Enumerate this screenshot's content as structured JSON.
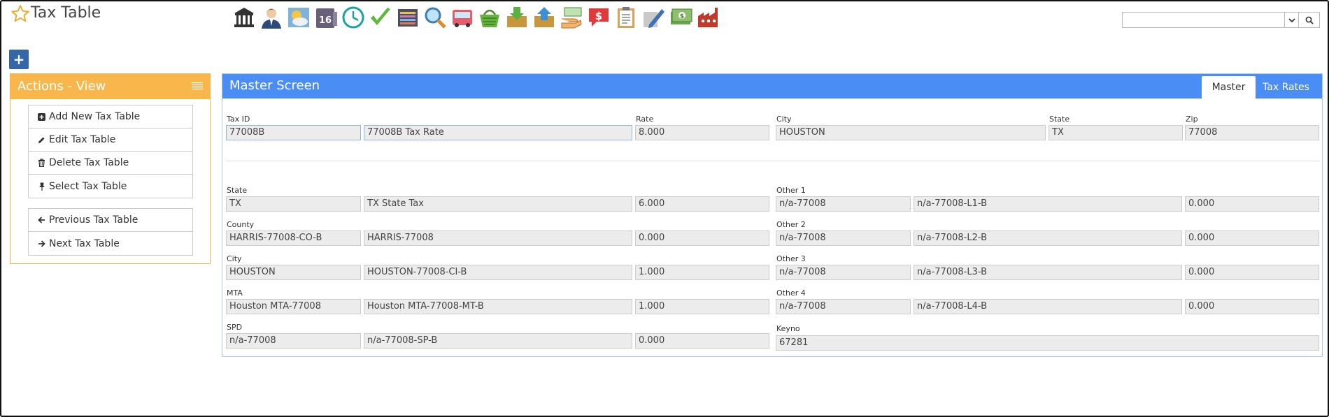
{
  "header": {
    "title": "Tax Table"
  },
  "toolbar": {
    "icons": [
      "bank-icon",
      "user-icon",
      "weather-icon",
      "calendar-icon",
      "clock-icon",
      "checkmark-icon",
      "register-icon",
      "magnifier-icon",
      "bus-icon",
      "basket-icon",
      "download-box-icon",
      "upload-box-icon",
      "cash-hand-icon",
      "chat-dollar-icon",
      "clipboard-icon",
      "pencil-ruler-icon",
      "money-stack-icon",
      "factory-icon"
    ],
    "calendar_day": "16"
  },
  "search": {
    "value": "",
    "placeholder": ""
  },
  "actions": {
    "title": "Actions - View",
    "items": [
      "Add New Tax Table",
      "Edit Tax Table",
      "Delete Tax Table",
      "Select Tax Table"
    ],
    "nav": [
      "Previous Tax Table",
      "Next Tax Table"
    ]
  },
  "master": {
    "title": "Master Screen",
    "tabs": [
      "Master",
      "Tax Rates"
    ],
    "top": {
      "tax_id_label": "Tax ID",
      "tax_id": "77008B",
      "description": "77008B Tax Rate",
      "rate_label": "Rate",
      "rate": "8.000",
      "city_label": "City",
      "city": "HOUSTON",
      "state_label": "State",
      "state": "TX",
      "zip_label": "Zip",
      "zip": "77008"
    },
    "left_rows": [
      {
        "label": "State",
        "code": "TX",
        "desc": "TX State Tax",
        "rate": "6.000"
      },
      {
        "label": "County",
        "code": "HARRIS-77008-CO-B",
        "desc": "HARRIS-77008",
        "rate": "0.000"
      },
      {
        "label": "City",
        "code": "HOUSTON",
        "desc": "HOUSTON-77008-CI-B",
        "rate": "1.000"
      },
      {
        "label": "MTA",
        "code": "Houston MTA-77008",
        "desc": "Houston MTA-77008-MT-B",
        "rate": "1.000"
      },
      {
        "label": "SPD",
        "code": "n/a-77008",
        "desc": "n/a-77008-SP-B",
        "rate": "0.000"
      }
    ],
    "right_rows": [
      {
        "label": "Other 1",
        "code": "n/a-77008",
        "desc": "n/a-77008-L1-B",
        "rate": "0.000"
      },
      {
        "label": "Other 2",
        "code": "n/a-77008",
        "desc": "n/a-77008-L2-B",
        "rate": "0.000"
      },
      {
        "label": "Other 3",
        "code": "n/a-77008",
        "desc": "n/a-77008-L3-B",
        "rate": "0.000"
      },
      {
        "label": "Other 4",
        "code": "n/a-77008",
        "desc": "n/a-77008-L4-B",
        "rate": "0.000"
      }
    ],
    "keyno_label": "Keyno",
    "keyno": "67281"
  }
}
